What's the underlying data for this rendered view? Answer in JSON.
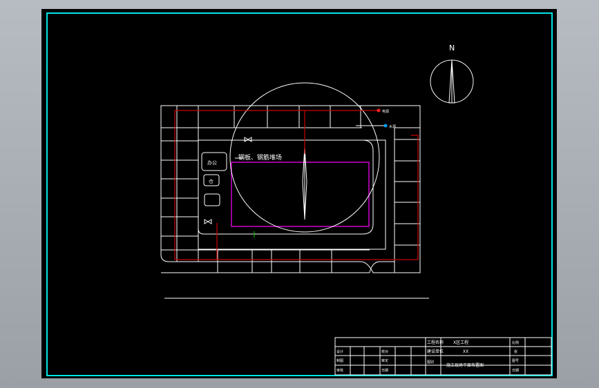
{
  "drawing": {
    "north_label": "N",
    "legend": {
      "power": "电源",
      "water": "水源"
    },
    "building": {
      "title": "钢板、钢筋堆场",
      "label_1": "办公",
      "label_2": "仓"
    },
    "title_block": {
      "project_label": "工程名称",
      "project_value": "X区工程",
      "design_unit_label": "建设单位",
      "design_unit_value": "XX",
      "drawing_name": "施工现场平面布置图",
      "cell_a": "设计",
      "cell_b": "制图",
      "cell_c": "审核",
      "cell_d": "校对",
      "cell_e": "审定",
      "cell_f": "日期",
      "cell_g": "比例",
      "cell_h": "图号",
      "cell_i": "张",
      "cell_j": "日期",
      "cell_k": "图别"
    }
  },
  "colors": {
    "background": "#000000",
    "frame": "#00e5e5",
    "lines": "#ffffff",
    "power_line": "#cc0000",
    "storage_area": "#d000d0",
    "water_point": "#00a0ff",
    "marker": "#00cc00"
  }
}
